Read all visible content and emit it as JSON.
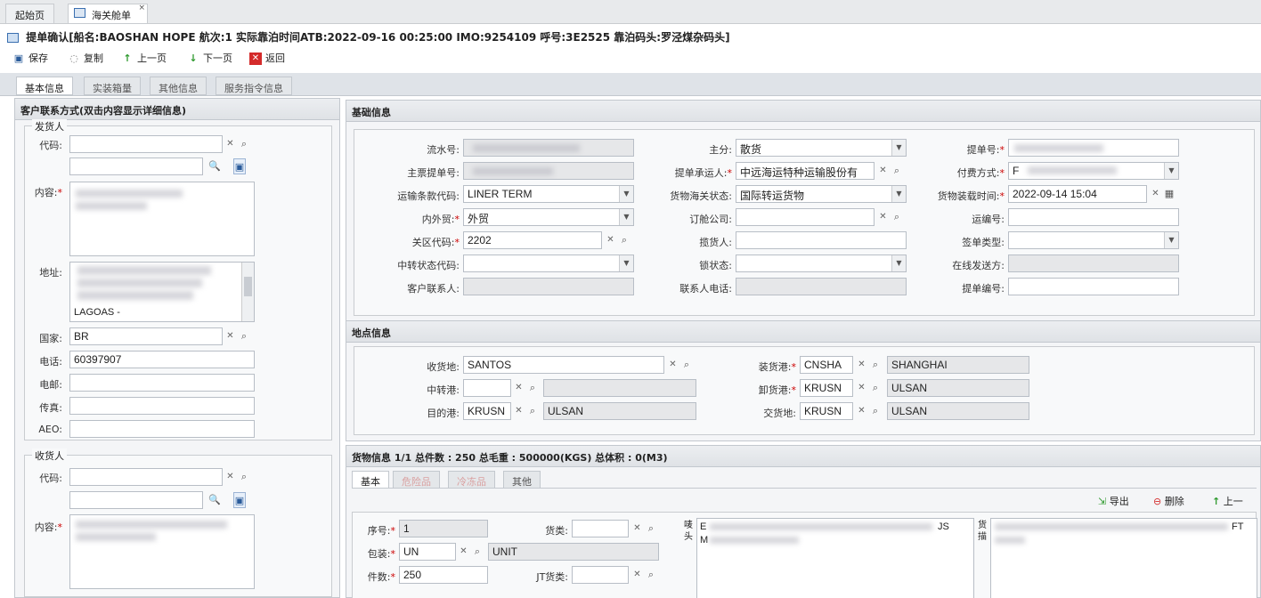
{
  "tabs": [
    {
      "label": "起始页"
    },
    {
      "label": "海关舱单"
    }
  ],
  "title": "提单确认[船名:BAOSHAN HOPE 航次:1 实际靠泊时间ATB:2022-09-16 00:25:00 IMO:9254109 呼号:3E2525 靠泊码头:罗泾煤杂码头]",
  "toolbar": {
    "save": "保存",
    "copy": "复制",
    "prev": "上一页",
    "next": "下一页",
    "back": "返回"
  },
  "subtabs": [
    "基本信息",
    "实装箱量",
    "其他信息",
    "服务指令信息"
  ],
  "left": {
    "header": "客户联系方式(双击内容显示详细信息)",
    "shipper": {
      "legend": "发货人",
      "code_label": "代码:",
      "content_label": "内容:",
      "address_label": "地址:",
      "address_tail": "LAGOAS -",
      "country_label": "国家:",
      "country": "BR",
      "phone_label": "电话:",
      "phone": "60397907",
      "email_label": "电邮:",
      "fax_label": "传真:",
      "aeo_label": "AEO:"
    },
    "consignee": {
      "legend": "收货人",
      "code_label": "代码:",
      "content_label": "内容:"
    }
  },
  "basic": {
    "header": "基础信息",
    "serial_label": "流水号:",
    "main_bl_label": "主票提单号:",
    "transport_terms_label": "运输条款代码:",
    "transport_terms": "LINER TERM",
    "trade_label": "内外贸:",
    "trade": "外贸",
    "customs_label": "关区代码:",
    "customs": "2202",
    "transit_label": "中转状态代码:",
    "contact_label": "客户联系人:",
    "split_label": "主分:",
    "split": "散货",
    "carrier_label": "提单承运人:",
    "carrier": "中远海运特种运输股份有",
    "customs_status_label": "货物海关状态:",
    "customs_status": "国际转运货物",
    "booking_label": "订舱公司:",
    "forwarder_label": "揽货人:",
    "hold_label": "锁状态:",
    "contact_phone_label": "联系人电话:",
    "bl_no_label": "提单号:",
    "payment_label": "付费方式:",
    "payment": "F",
    "loading_time_label": "货物装载时间:",
    "loading_time": "2022-09-14 15:04",
    "waybill_label": "运编号:",
    "sign_type_label": "签单类型:",
    "online_send_label": "在线发送方:",
    "bl_code_label": "提单编号:"
  },
  "location": {
    "header": "地点信息",
    "receipt_label": "收货地:",
    "receipt": "SANTOS",
    "transship_label": "中转港:",
    "dest_label": "目的港:",
    "dest_code": "KRUSN",
    "dest_name": "ULSAN",
    "load_label": "装货港:",
    "load_code": "CNSHA",
    "load_name": "SHANGHAI",
    "discharge_label": "卸货港:",
    "discharge_code": "KRUSN",
    "discharge_name": "ULSAN",
    "delivery_label": "交货地:",
    "delivery_code": "KRUSN",
    "delivery_name": "ULSAN"
  },
  "cargo": {
    "header": "货物信息 1/1 总件数 : 250 总毛重 : 500000(KGS) 总体积 : 0(M3)",
    "tabs": [
      "基本",
      "危险品",
      "冷冻品",
      "其他"
    ],
    "actions": {
      "export": "导出",
      "delete": "删除",
      "up": "上一"
    },
    "seq_label": "序号:",
    "seq": "1",
    "pkg_label": "包装:",
    "pkg_code": "UN",
    "pkg_name": "UNIT",
    "count_label": "件数:",
    "count": "250",
    "goods_label": "货类:",
    "jt_label": "JT货类:",
    "mark_label": "唛头",
    "mark_text_1": "E",
    "mark_text_2": "JS",
    "mark_text_3": "M",
    "desc_label": "货描",
    "desc_text": "FT"
  },
  "colors": {
    "accent": "#3a6fb0",
    "required": "#cc0000",
    "readonly": "#e6e7e9"
  }
}
